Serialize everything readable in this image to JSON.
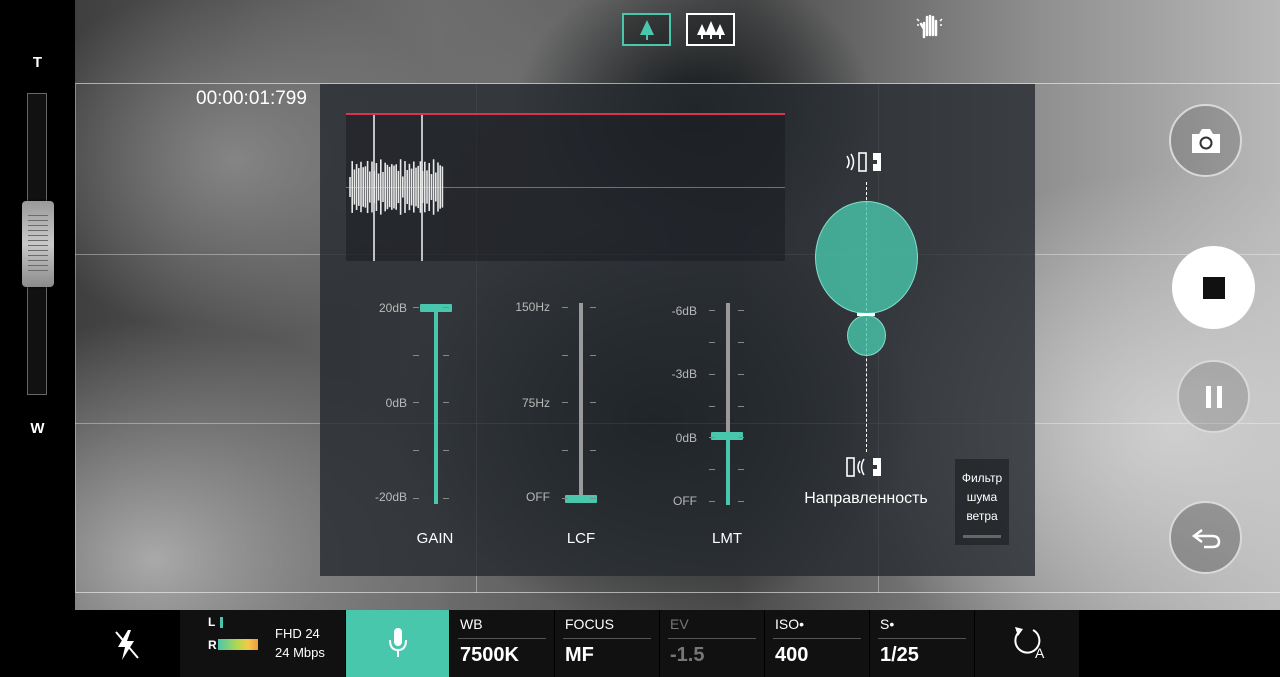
{
  "zoom": {
    "top_label": "T",
    "bottom_label": "W"
  },
  "timecode": "00:00:01:799",
  "top_modes": [
    {
      "name": "single-tree-icon",
      "selected": true
    },
    {
      "name": "forest-icon",
      "selected": false
    }
  ],
  "panel": {
    "gain": {
      "label": "GAIN",
      "ticks": [
        "20dB",
        "0dB",
        "-20dB"
      ],
      "value": "20dB"
    },
    "lcf": {
      "label": "LCF",
      "ticks": [
        "150Hz",
        "75Hz",
        "OFF"
      ],
      "value": "OFF"
    },
    "lmt": {
      "label": "LMT",
      "ticks": [
        "-6dB",
        "-3dB",
        "0dB",
        "OFF"
      ],
      "value": "0dB"
    },
    "directivity_label": "Направленность",
    "wind_filter_label": "Фильтр шума ветра"
  },
  "bottom": {
    "audio_meter": {
      "l": "L",
      "r": "R"
    },
    "format": "FHD 24",
    "bitrate": "24 Mbps",
    "wb": {
      "label": "WB",
      "value": "7500K"
    },
    "focus": {
      "label": "FOCUS",
      "value": "MF"
    },
    "ev": {
      "label": "EV",
      "value": "-1.5"
    },
    "iso": {
      "label": "ISO•",
      "value": "400"
    },
    "shutter": {
      "label": "S•",
      "value": "1/25"
    }
  },
  "colors": {
    "accent": "#49c7ad",
    "peak_line": "#d6344f"
  }
}
